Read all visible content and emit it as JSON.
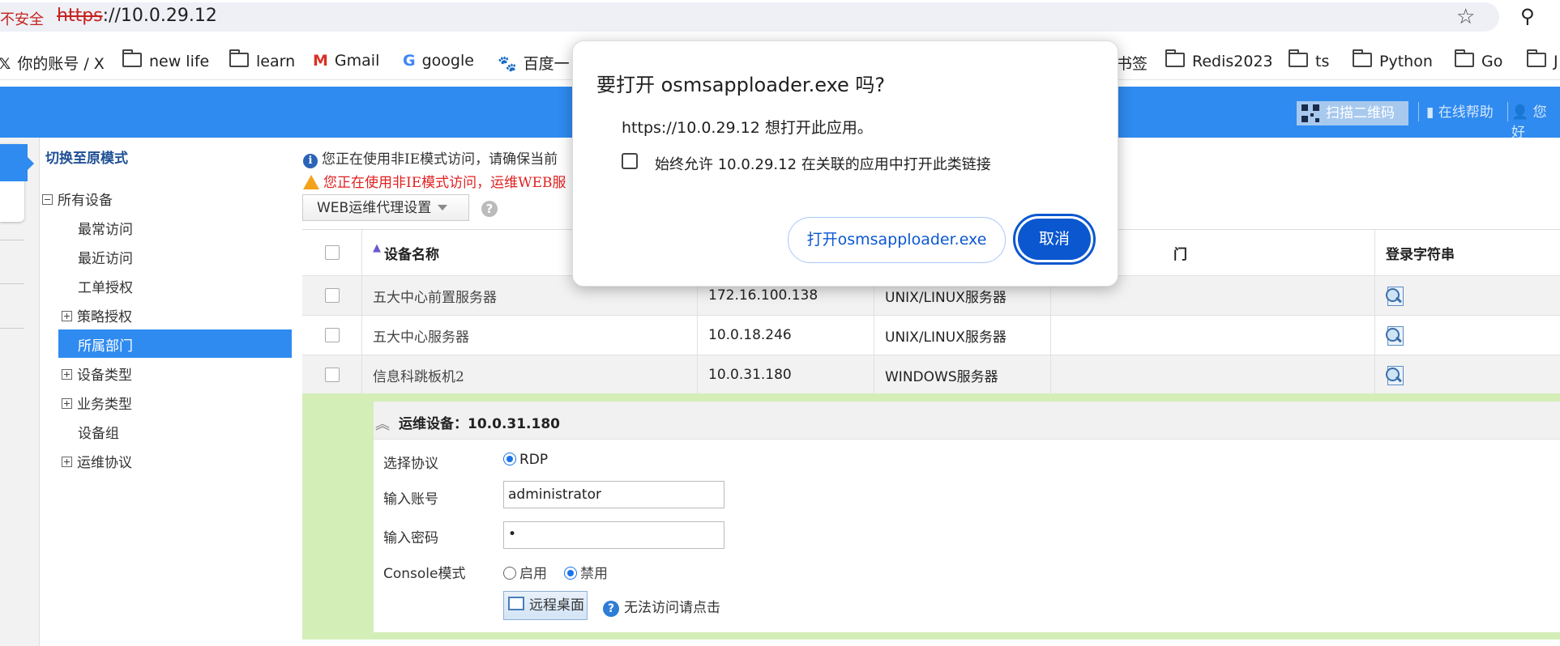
{
  "browser": {
    "insecure_label": "不安全",
    "url_protocol": "https",
    "url_rest": "://10.0.29.12",
    "bookmarks": [
      {
        "icon": "x-logo-icon",
        "label": "你的账号 / X"
      },
      {
        "icon": "folder-icon",
        "label": "new life"
      },
      {
        "icon": "folder-icon",
        "label": "learn"
      },
      {
        "icon": "gmail-icon",
        "label": "Gmail"
      },
      {
        "icon": "google-icon",
        "label": "google"
      },
      {
        "icon": "baidu-paw-icon",
        "label": "百度一"
      },
      {
        "icon": "none",
        "label": "书签"
      },
      {
        "icon": "folder-icon",
        "label": "Redis2023"
      },
      {
        "icon": "folder-icon",
        "label": "ts"
      },
      {
        "icon": "folder-icon",
        "label": "Python"
      },
      {
        "icon": "folder-icon",
        "label": "Go"
      },
      {
        "icon": "folder-icon",
        "label": "J"
      }
    ]
  },
  "header": {
    "qr_label": "扫描二维码",
    "help_label": "在线帮助",
    "user_label": "您好"
  },
  "sidebar": {
    "switch_mode": "切换至原模式",
    "tree": [
      {
        "label": "所有设备",
        "toggle": "minus"
      },
      {
        "label": "最常访问",
        "toggle": "none"
      },
      {
        "label": "最近访问",
        "toggle": "none"
      },
      {
        "label": "工单授权",
        "toggle": "none"
      },
      {
        "label": "策略授权",
        "toggle": "plus"
      },
      {
        "label": "所属部门",
        "toggle": "none",
        "selected": true
      },
      {
        "label": "设备类型",
        "toggle": "plus"
      },
      {
        "label": "业务类型",
        "toggle": "plus"
      },
      {
        "label": "设备组",
        "toggle": "none"
      },
      {
        "label": "运维协议",
        "toggle": "plus"
      }
    ]
  },
  "notices": {
    "info": "您正在使用非IE模式访问，请确保当前",
    "warn": "您正在使用非IE模式访问，运维WEB服"
  },
  "toolbar": {
    "web_proxy_label": "WEB运维代理设置"
  },
  "table": {
    "headers": {
      "name": "设备名称",
      "dept": "门",
      "login": "登录字符串"
    },
    "rows": [
      {
        "name": "五大中心前置服务器",
        "ip": "172.16.100.138",
        "type": "UNIX/LINUX服务器",
        "dept": ""
      },
      {
        "name": "五大中心服务器",
        "ip": "10.0.18.246",
        "type": "UNIX/LINUX服务器",
        "dept": ""
      },
      {
        "name": "信息科跳板机2",
        "ip": "10.0.31.180",
        "type": "WINDOWS服务器",
        "dept": ""
      }
    ]
  },
  "detail": {
    "title_prefix": "运维设备：",
    "title_value": "10.0.31.180",
    "protocol_label": "选择协议",
    "protocol_value": "RDP",
    "account_label": "输入账号",
    "account_value": "administrator",
    "password_label": "输入密码",
    "password_value": "•",
    "console_label": "Console模式",
    "console_enable": "启用",
    "console_disable": "禁用",
    "console_selected": "禁用",
    "remote_button": "远程桌面",
    "cant_access": "无法访问请点击"
  },
  "dialog": {
    "title": "要打开 osmsapploader.exe 吗?",
    "message": "https://10.0.29.12 想打开此应用。",
    "checkbox_label": "始终允许 10.0.29.12 在关联的应用中打开此类链接",
    "open_button": "打开osmsapploader.exe",
    "cancel_button": "取消"
  },
  "colors": {
    "header_blue": "#2f8bf0",
    "detail_green": "#d4eeb8",
    "dialog_primary": "#0b57d0"
  }
}
